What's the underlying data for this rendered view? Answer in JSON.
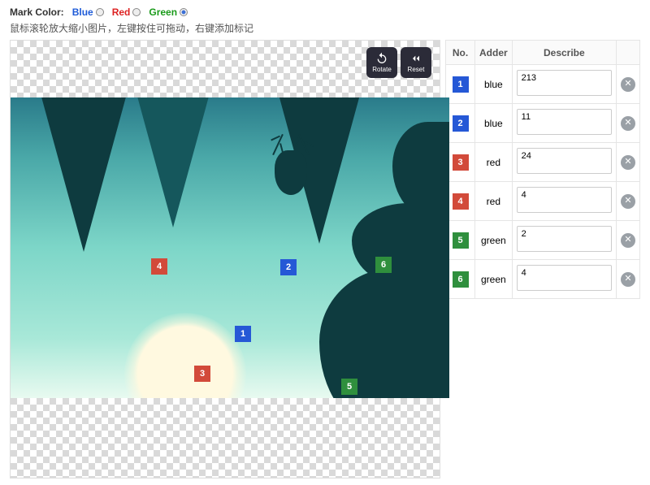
{
  "header": {
    "markColorLabel": "Mark Color:",
    "options": [
      {
        "label": "Blue",
        "value": "blue",
        "selected": false
      },
      {
        "label": "Red",
        "value": "red",
        "selected": false
      },
      {
        "label": "Green",
        "value": "green",
        "selected": true
      }
    ],
    "hint": "鼠标滚轮放大缩小图片，左键按住可拖动，右键添加标记"
  },
  "controls": {
    "rotate": "Rotate",
    "reset": "Reset"
  },
  "table": {
    "headers": {
      "no": "No.",
      "adder": "Adder",
      "describe": "Describe"
    }
  },
  "markers": [
    {
      "no": "1",
      "color": "blue",
      "adder": "blue",
      "describe": "213"
    },
    {
      "no": "2",
      "color": "blue",
      "adder": "blue",
      "describe": "11"
    },
    {
      "no": "3",
      "color": "red",
      "adder": "red",
      "describe": "24"
    },
    {
      "no": "4",
      "color": "red",
      "adder": "red",
      "describe": "4"
    },
    {
      "no": "5",
      "color": "green",
      "adder": "green",
      "describe": "2"
    },
    {
      "no": "6",
      "color": "green",
      "adder": "green",
      "describe": "4"
    }
  ],
  "colors": {
    "blue": "#2558d6",
    "red": "#d24a3a",
    "green": "#2f8f3d"
  }
}
